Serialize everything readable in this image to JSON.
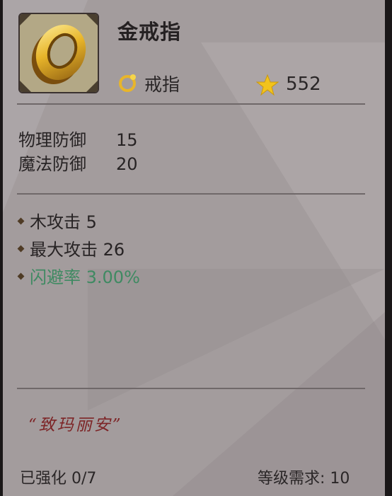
{
  "item": {
    "name": "金戒指",
    "type_label": "戒指",
    "type_icon": "ring-type-icon",
    "score": "552",
    "score_icon": "star-icon"
  },
  "base_stats": [
    {
      "label": "物理防御",
      "value": "15"
    },
    {
      "label": "魔法防御",
      "value": "20"
    }
  ],
  "attributes": [
    {
      "text": "木攻击 5"
    },
    {
      "text": "最大攻击 26"
    },
    {
      "text": "闪避率 3.00%"
    }
  ],
  "flavor_text": "“致玛丽安”",
  "footer": {
    "enhance": "已强化 0/7",
    "level_requirement": "等级需求: 10"
  },
  "colors": {
    "panel_bg": "#a39c9d",
    "special_attr": "#3f8a62",
    "flavor": "#7d2426",
    "gold": "#e8b52a"
  }
}
